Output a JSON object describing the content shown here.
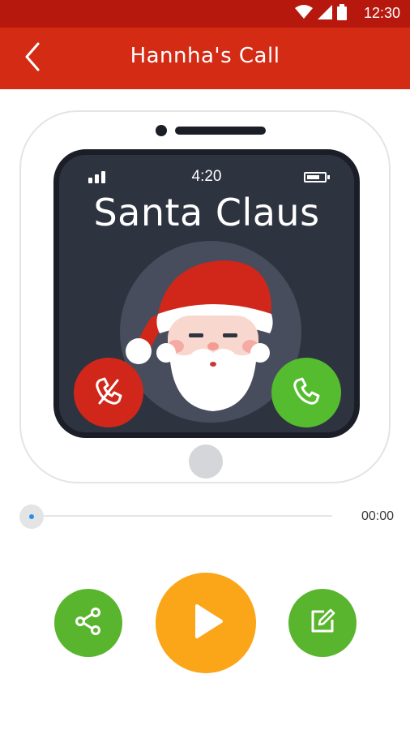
{
  "status_bar": {
    "time": "12:30",
    "icons": [
      "wifi-icon",
      "cell-signal-icon",
      "battery-icon"
    ],
    "background": "#b6180e"
  },
  "app_bar": {
    "title": "Hannha's Call",
    "back_icon": "chevron-left-icon",
    "background": "#d42b15"
  },
  "preview": {
    "phone_time": "4:20",
    "caller_name": "Santa Claus",
    "avatar": "santa-claus-avatar",
    "decline_icon": "phone-hangup-icon",
    "accept_icon": "phone-icon",
    "decline_color": "#d0271a",
    "accept_color": "#55bb2f",
    "screen_color": "#2e3340"
  },
  "player": {
    "elapsed": "00:00",
    "progress": 0
  },
  "actions": {
    "share_icon": "share-icon",
    "play_icon": "play-icon",
    "edit_icon": "edit-note-icon",
    "share_color": "#5ab52e",
    "play_color": "#fba519",
    "edit_color": "#5ab52e"
  }
}
